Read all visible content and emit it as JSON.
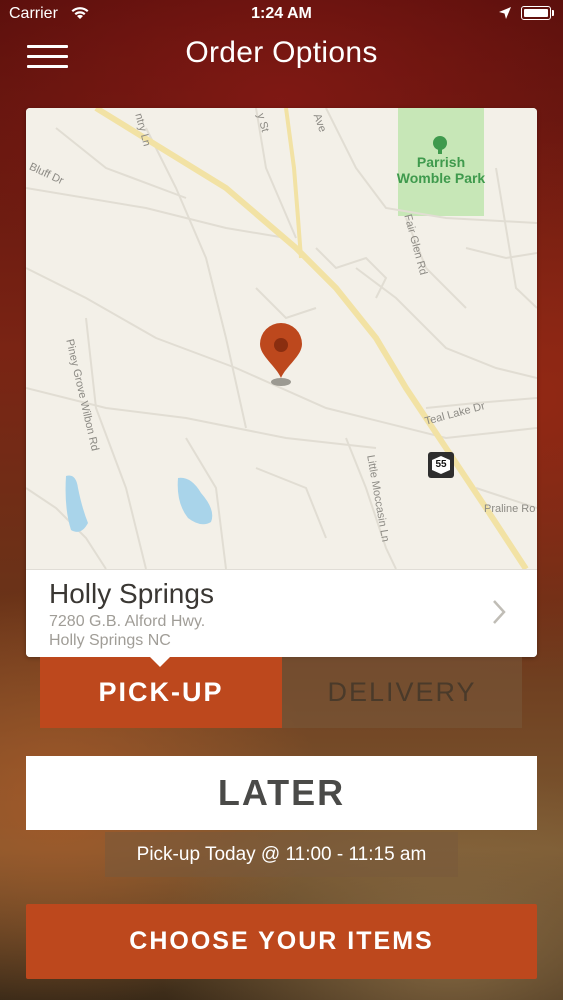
{
  "status_bar": {
    "carrier": "Carrier",
    "time": "1:24 AM",
    "wifi_icon": "wifi-icon",
    "location_icon": "location-arrow-icon",
    "battery_icon": "battery-icon"
  },
  "nav": {
    "title": "Order Options",
    "menu_icon": "hamburger-menu-icon"
  },
  "map": {
    "labels": {
      "park": "Parrish\nWomble Park",
      "pine_grove": "Piney Grove Wilbon Rd",
      "teal_lake": "Teal Lake Dr",
      "little_moccasin": "Little Moccasin Ln",
      "praline": "Praline Ro",
      "fair_glen": "Fair Glen Rd",
      "bluff": "Bluff Dr",
      "country": "ntry Ln",
      "y_st": "y St",
      "ave": "Ave",
      "route": "55"
    },
    "pin_icon": "map-pin-icon",
    "accent_color": "#bd481d"
  },
  "location": {
    "name": "Holly Springs",
    "address_line1": "7280 G.B. Alford Hwy.",
    "address_line2": "Holly Springs NC",
    "chevron_icon": "chevron-right-icon"
  },
  "order_type": {
    "pickup_label": "PICK-UP",
    "delivery_label": "DELIVERY",
    "selected": "PICK-UP"
  },
  "timing": {
    "later_label": "LATER",
    "pickup_time_text": "Pick-up Today @ 11:00 - 11:15 am"
  },
  "cta": {
    "choose_label": "CHOOSE YOUR ITEMS"
  }
}
